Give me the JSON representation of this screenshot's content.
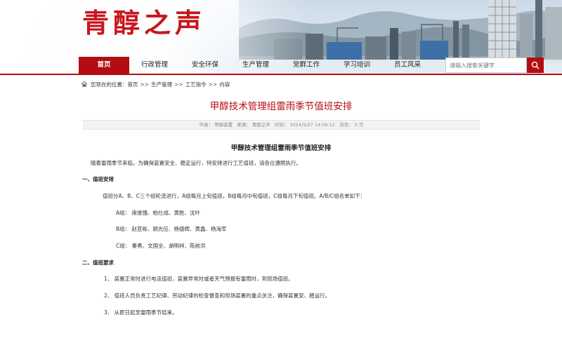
{
  "header": {
    "site_title": "青醇之声"
  },
  "nav": {
    "items": [
      {
        "label": "首页",
        "active": true
      },
      {
        "label": "行政管理",
        "active": false
      },
      {
        "label": "安全环保",
        "active": false
      },
      {
        "label": "生产管理",
        "active": false
      },
      {
        "label": "党群工作",
        "active": false
      },
      {
        "label": "学习培训",
        "active": false
      },
      {
        "label": "员工风采",
        "active": false
      }
    ],
    "search_placeholder": "请输入搜索关键字",
    "search_icon": "search-icon"
  },
  "breadcrumb": {
    "prefix": "您现在的位置：",
    "items": [
      "首页",
      "生产管理",
      "工艺指令",
      "内容"
    ],
    "separator": ">>"
  },
  "article": {
    "title": "甲醇技术管理组雷雨季节值班安排",
    "meta": {
      "author": "作者：  甲醇装置",
      "source": "来源：  青醇之声",
      "time": "时间：  2024/5/27 14:06:12",
      "views": "浏览：  0 次"
    },
    "content_title": "甲醇技术管理组雷雨季节值班安排",
    "intro": "随着雷雨季节来临，为确保装置安全、稳定运行，特安排进行工艺值班，请各位遵照执行。",
    "section1": {
      "heading": "一、值班安排",
      "desc": "值班分A、B、C三个组轮流进行，A组每月上旬值班，B组每月中旬值班，C组每月下旬值班。A/B/C组名单如下：",
      "group_a": "A组：  席维强、柏仕成、黄胜、沈叶",
      "group_b": "B组：  赵亚彬、顾光应、杨德辉、黄鑫、杨海军",
      "group_c": "C组：  秦勇、文国全、胡明祥、陈前洪"
    },
    "section2": {
      "heading": "二、值班要求",
      "item1": "1、  装置正常时进行电话值班，装置异常时或者天气预报有雷雨时，到现场值班。",
      "item2": "2、  值班人员负责工艺纪律、劳动纪律的检查督查和现场装置的重点关注，确保装置安、稳运行。",
      "item3": "3、  从即日起至雷雨季节结束。"
    }
  },
  "colors": {
    "brand_red": "#b30d12",
    "title_red": "#c8161d"
  }
}
